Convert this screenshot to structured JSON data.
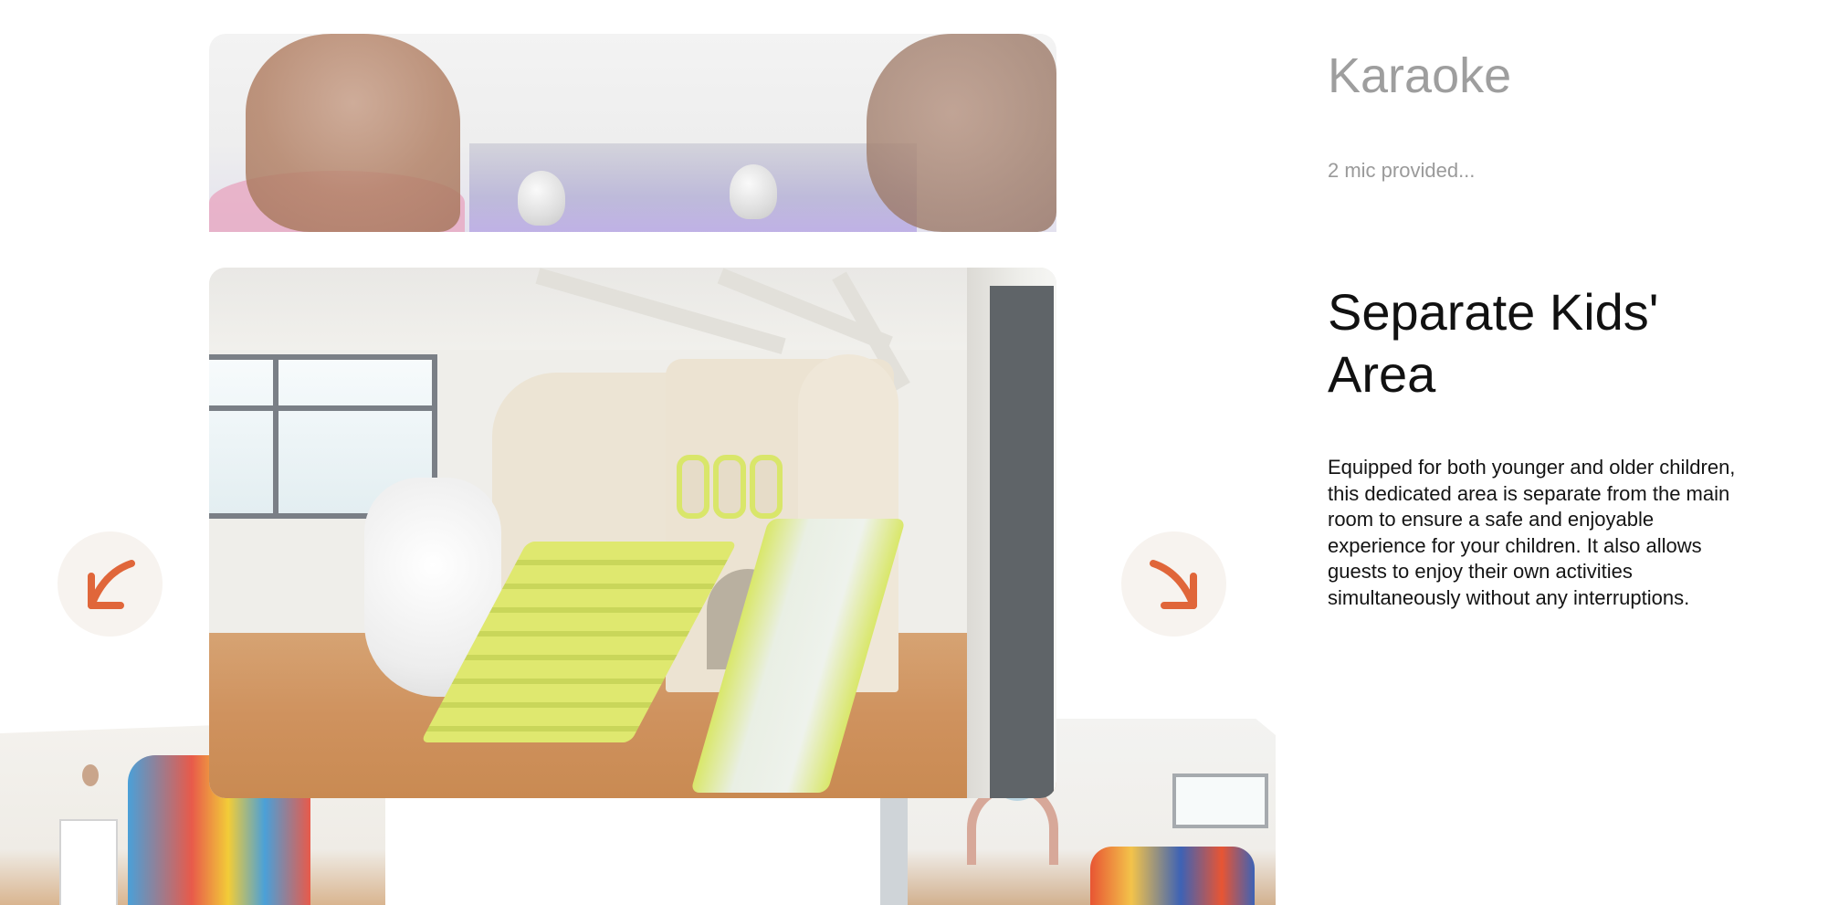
{
  "carousel": {
    "previous_slide": {
      "title": "Karaoke",
      "description": "2 mic provided..."
    },
    "current_slide": {
      "title": "Separate Kids' Area",
      "description": "Equipped for both younger and older children, this dedicated area is separate from the main room to ensure a safe and enjoyable experience for your children. It also allows guests to enjoy their own activities simultaneously without any interruptions."
    },
    "nav": {
      "prev_icon": "arrow-down-left-icon",
      "next_icon": "arrow-down-right-icon"
    }
  },
  "colors": {
    "accent": "#E0663A",
    "button_bg": "#F7F3EF",
    "muted_text": "#9E9E9E",
    "body_text": "#141414"
  }
}
